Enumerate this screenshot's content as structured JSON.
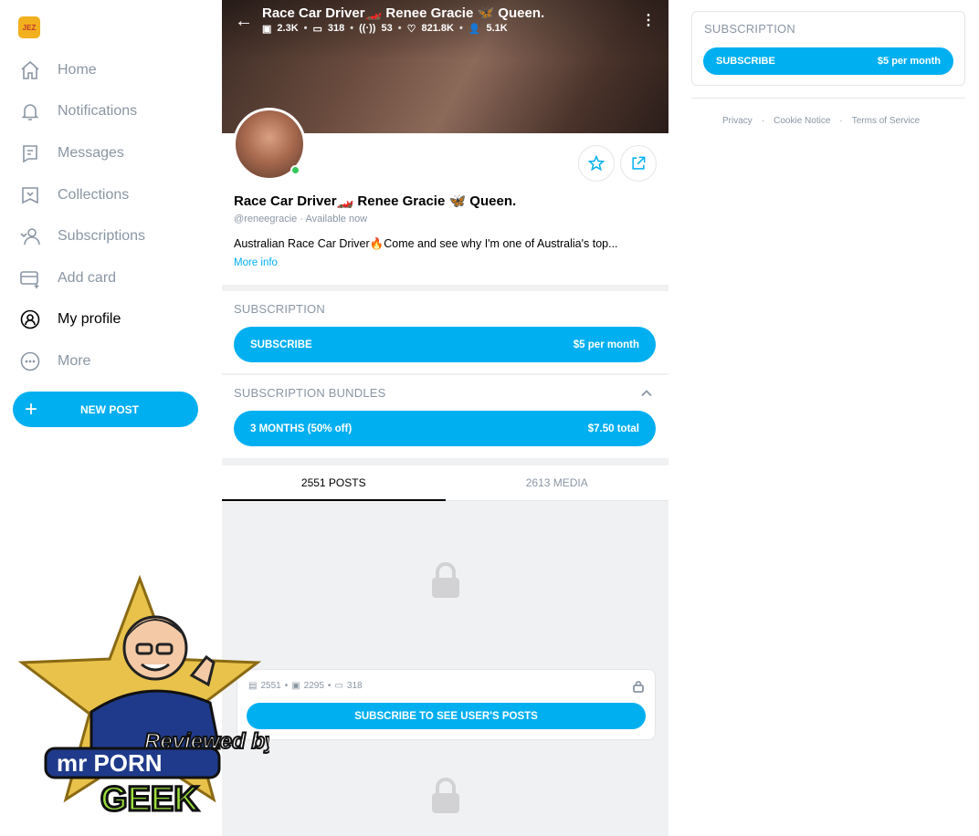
{
  "sidebar": {
    "logo_text": "JEZ",
    "items": [
      {
        "label": "Home",
        "icon": "home-icon"
      },
      {
        "label": "Notifications",
        "icon": "bell-icon"
      },
      {
        "label": "Messages",
        "icon": "message-icon"
      },
      {
        "label": "Collections",
        "icon": "bookmark-icon"
      },
      {
        "label": "Subscriptions",
        "icon": "subscriptions-icon"
      },
      {
        "label": "Add card",
        "icon": "card-icon"
      },
      {
        "label": "My profile",
        "icon": "profile-icon"
      },
      {
        "label": "More",
        "icon": "more-icon"
      }
    ],
    "active_item": "My profile",
    "new_post_label": "NEW POST"
  },
  "header": {
    "title": "Race Car Driver🏎️ Renee Gracie 🦋 Queen.",
    "stats": {
      "photos": "2.3K",
      "videos": "318",
      "streams": "53",
      "likes": "821.8K",
      "fans": "5.1K"
    }
  },
  "profile": {
    "name": "Race Car Driver🏎️ Renee Gracie 🦋 Queen.",
    "handle": "@reneegracie",
    "status": "Available now",
    "bio": "Australian Race Car Driver🔥Come and see why I'm one of Australia's top...",
    "more_info": "More info"
  },
  "subscription": {
    "title": "SUBSCRIPTION",
    "button_label": "SUBSCRIBE",
    "price": "$5 per month"
  },
  "bundles": {
    "title": "SUBSCRIPTION BUNDLES",
    "button_label": "3 MONTHS (50% off)",
    "price": "$7.50 total"
  },
  "tabs": [
    {
      "label": "2551 POSTS",
      "active": true
    },
    {
      "label": "2613 MEDIA",
      "active": false
    }
  ],
  "locked_post": {
    "posts": "2551",
    "photos": "2295",
    "videos": "318",
    "button_label": "SUBSCRIBE TO SEE USER'S POSTS"
  },
  "right_panel": {
    "title": "SUBSCRIPTION",
    "button_label": "SUBSCRIBE",
    "price": "$5 per month"
  },
  "footer": {
    "links": [
      "Privacy",
      "Cookie Notice",
      "Terms of Service"
    ],
    "separator": "·"
  },
  "watermark": {
    "line1": "Reviewed by",
    "line2": "mr PORN",
    "line3": "GEEK"
  },
  "colors": {
    "accent": "#00aff0",
    "muted": "#8a96a3",
    "online": "#34c759"
  }
}
